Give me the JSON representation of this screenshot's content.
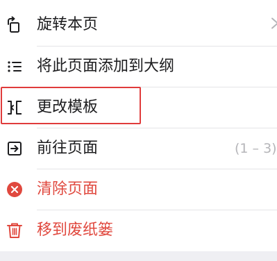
{
  "accent_colors": {
    "destructive": "#e0483e",
    "highlight_box": "#e03b3b",
    "trailing_text": "#b5b5b9"
  },
  "menu": {
    "items": [
      {
        "label": "旋转本页",
        "icon": "rotate-page-icon",
        "trailing": "",
        "destructive": false
      },
      {
        "label": "将此页面添加到大纲",
        "icon": "outline-list-icon",
        "trailing": "",
        "destructive": false
      },
      {
        "label": "更改模板",
        "icon": "change-template-icon",
        "trailing": "",
        "destructive": false,
        "highlighted": true
      },
      {
        "label": "前往页面",
        "icon": "go-to-page-icon",
        "trailing": "(1 – 3)",
        "destructive": false
      },
      {
        "label": "清除页面",
        "icon": "clear-page-icon",
        "trailing": "",
        "destructive": true
      },
      {
        "label": "移到废纸篓",
        "icon": "trash-icon",
        "trailing": "",
        "destructive": true
      }
    ]
  }
}
